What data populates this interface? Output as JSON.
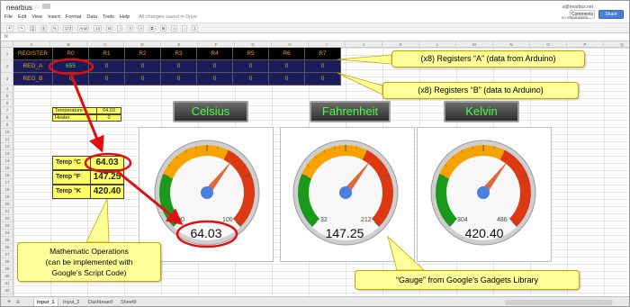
{
  "app": {
    "doc_title": "nearbus",
    "menu": [
      "File",
      "Edit",
      "View",
      "Insert",
      "Format",
      "Data",
      "Tools",
      "Help"
    ],
    "saved_status": "All changes saved in Drive",
    "user_email": "a@nearbus.net",
    "comments_label": "Comments",
    "share_label": "Share",
    "notice": "no email alerts",
    "toolbar_items": [
      "↶",
      "↷",
      "⎙",
      "$",
      "%",
      "123",
      "Arial",
      "10",
      "B",
      "I",
      "S",
      "A",
      "⧉",
      "⊞",
      "≡",
      "↕",
      "Σ"
    ]
  },
  "columns": [
    "",
    "A",
    "B",
    "C",
    "D",
    "E",
    "F",
    "G",
    "H",
    "I",
    "J",
    "K",
    "L",
    "M",
    "N",
    "O",
    "P",
    "Q"
  ],
  "rows": [
    "1",
    "2",
    "3",
    "4",
    "5",
    "6",
    "7",
    "8",
    "9",
    "10",
    "11",
    "12",
    "13",
    "14",
    "15",
    "16",
    "17",
    "18",
    "19",
    "20",
    "21",
    "22",
    "23",
    "24",
    "25",
    "26",
    "27",
    "28",
    "29",
    "30",
    "31",
    "32",
    "33",
    "34",
    "35"
  ],
  "registers": {
    "header": [
      "REGISTER",
      "R0",
      "R1",
      "R2",
      "R3",
      "R4",
      "R5",
      "R6",
      "R7"
    ],
    "reg_a": [
      "REG_A",
      "655",
      "0",
      "0",
      "0",
      "0",
      "0",
      "0",
      "0"
    ],
    "reg_b": [
      "REG_B",
      "0",
      "0",
      "0",
      "0",
      "0",
      "0",
      "0",
      "0"
    ]
  },
  "status_table": {
    "temperature_label": "Temperature",
    "temperature_value": "64.03",
    "heater_label": "Heater",
    "heater_value": "0"
  },
  "temps": {
    "c_label": "Temp °C",
    "c_value": "64.03",
    "f_label": "Temp °F",
    "f_value": "147.25",
    "k_label": "Temp °K",
    "k_value": "420.40"
  },
  "callouts": {
    "reg_a": "(x8) Registers “A” (data from Arduino)",
    "reg_b": "(x8) Registers “B” (data to Arduino)",
    "math_line1": "Mathematic Operations",
    "math_line2": "(can be implemented with",
    "math_line3": "Google’s Script Code)",
    "gauge": "“Gauge” from Google’s Gadgets Library"
  },
  "gauges": [
    {
      "title": "Celsius",
      "value": 64.03,
      "display": "64.03",
      "min": 0,
      "max": 100,
      "min_label": "0",
      "max_label": "100"
    },
    {
      "title": "Fahrenheit",
      "value": 147.25,
      "display": "147.25",
      "min": 32,
      "max": 212,
      "min_label": "32",
      "max_label": "212"
    },
    {
      "title": "Kelvin",
      "value": 420.4,
      "display": "420.40",
      "min": 304,
      "max": 486,
      "min_label": "304",
      "max_label": "486"
    }
  ],
  "sheet_tabs": [
    "Input_1",
    "Input_2",
    "Dashboard",
    "Sheet9"
  ],
  "colors": {
    "highlight_red": "#e01010",
    "callout_yellow": "#ffff99",
    "gauge_title_green": "#44ff44",
    "register_orange": "#f2a21b",
    "register_green": "#7fd45a"
  }
}
